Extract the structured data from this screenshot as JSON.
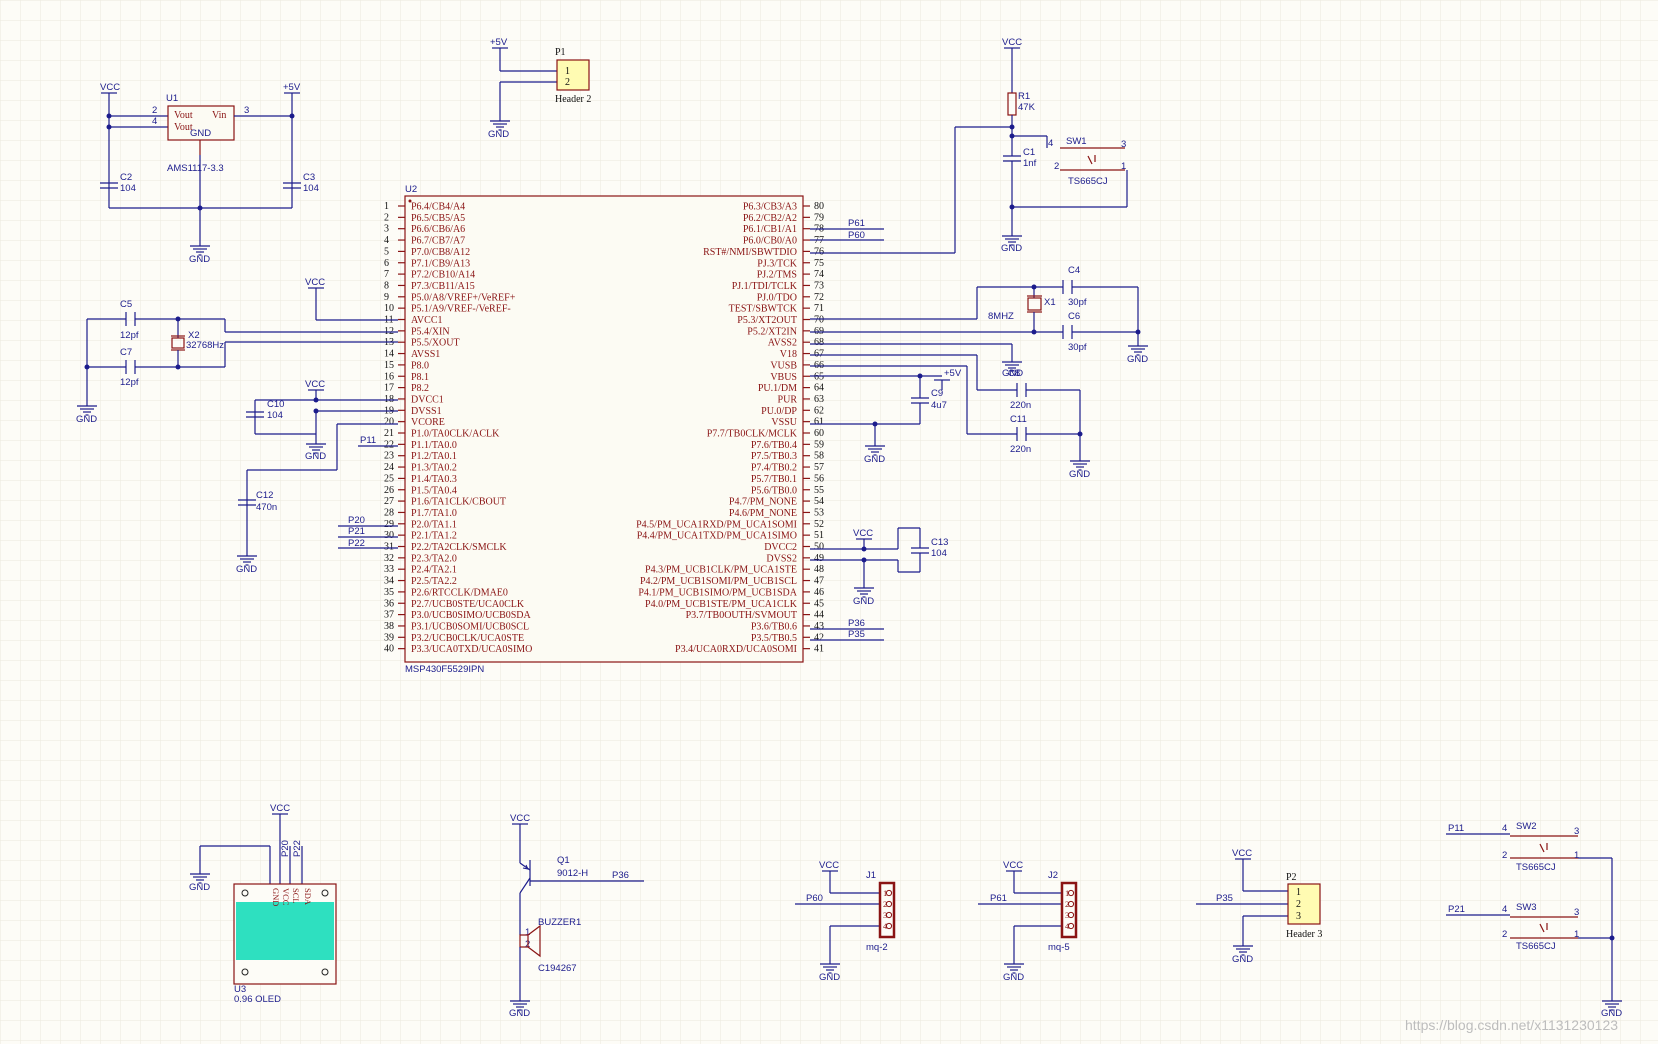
{
  "watermark": "https://blog.csdn.net/x1131230123",
  "mcu": {
    "designator": "U2",
    "part": "MSP430F5529IPN",
    "left_pins": [
      "P6.4/CB4/A4",
      "P6.5/CB5/A5",
      "P6.6/CB6/A6",
      "P6.7/CB7/A7",
      "P7.0/CB8/A12",
      "P7.1/CB9/A13",
      "P7.2/CB10/A14",
      "P7.3/CB11/A15",
      "P5.0/A8/VREF+/VeREF+",
      "P5.1/A9/VREF-/VeREF-",
      "AVCC1",
      "P5.4/XIN",
      "P5.5/XOUT",
      "AVSS1",
      "P8.0",
      "P8.1",
      "P8.2",
      "DVCC1",
      "DVSS1",
      "VCORE",
      "P1.0/TA0CLK/ACLK",
      "P1.1/TA0.0",
      "P1.2/TA0.1",
      "P1.3/TA0.2",
      "P1.4/TA0.3",
      "P1.5/TA0.4",
      "P1.6/TA1CLK/CBOUT",
      "P1.7/TA1.0",
      "P2.0/TA1.1",
      "P2.1/TA1.2",
      "P2.2/TA2CLK/SMCLK",
      "P2.3/TA2.0",
      "P2.4/TA2.1",
      "P2.5/TA2.2",
      "P2.6/RTCCLK/DMAE0",
      "P2.7/UCB0STE/UCA0CLK",
      "P3.0/UCB0SIMO/UCB0SDA",
      "P3.1/UCB0SOMI/UCB0SCL",
      "P3.2/UCB0CLK/UCA0STE",
      "P3.3/UCA0TXD/UCA0SIMO"
    ],
    "right_pins": [
      "P6.3/CB3/A3",
      "P6.2/CB2/A2",
      "P6.1/CB1/A1",
      "P6.0/CB0/A0",
      "RST#/NMI/SBWTDIO",
      "PJ.3/TCK",
      "PJ.2/TMS",
      "PJ.1/TDI/TCLK",
      "PJ.0/TDO",
      "TEST/SBWTCK",
      "P5.3/XT2OUT",
      "P5.2/XT2IN",
      "AVSS2",
      "V18",
      "VUSB",
      "VBUS",
      "PU.1/DM",
      "PUR",
      "PU.0/DP",
      "VSSU",
      "P7.7/TB0CLK/MCLK",
      "P7.6/TB0.4",
      "P7.5/TB0.3",
      "P7.4/TB0.2",
      "P5.7/TB0.1",
      "P5.6/TB0.0",
      "P4.7/PM_NONE",
      "P4.6/PM_NONE",
      "P4.5/PM_UCA1RXD/PM_UCA1SOMI",
      "P4.4/PM_UCA1TXD/PM_UCA1SIMO",
      "DVCC2",
      "DVSS2",
      "P4.3/PM_UCB1CLK/PM_UCA1STE",
      "P4.2/PM_UCB1SOMI/PM_UCB1SCL",
      "P4.1/PM_UCB1SIMO/PM_UCB1SDA",
      "P4.0/PM_UCB1STE/PM_UCA1CLK",
      "P3.7/TB0OUTH/SVMOUT",
      "P3.6/TB0.6",
      "P3.5/TB0.5",
      "P3.4/UCA0RXD/UCA0SOMI"
    ],
    "left_pin_numbers": [
      "1",
      "2",
      "3",
      "4",
      "5",
      "6",
      "7",
      "8",
      "9",
      "10",
      "11",
      "12",
      "13",
      "14",
      "15",
      "16",
      "17",
      "18",
      "19",
      "20",
      "21",
      "22",
      "23",
      "24",
      "25",
      "26",
      "27",
      "28",
      "29",
      "30",
      "31",
      "32",
      "33",
      "34",
      "35",
      "36",
      "37",
      "38",
      "39",
      "40"
    ],
    "right_pin_numbers": [
      "80",
      "79",
      "78",
      "77",
      "76",
      "75",
      "74",
      "73",
      "72",
      "71",
      "70",
      "69",
      "68",
      "67",
      "66",
      "65",
      "64",
      "63",
      "62",
      "61",
      "60",
      "59",
      "58",
      "57",
      "56",
      "55",
      "54",
      "53",
      "52",
      "51",
      "50",
      "49",
      "48",
      "47",
      "46",
      "45",
      "44",
      "43",
      "42",
      "41"
    ],
    "net_labels": {
      "p61": "P61",
      "p60": "P60",
      "p36": "P36",
      "p35": "P35",
      "p11": "P11",
      "p20": "P20",
      "p21": "P21",
      "p22": "P22"
    }
  },
  "regulator": {
    "designator": "U1",
    "part": "AMS1117-3.3",
    "pin_vout1": "Vout",
    "pin_vout2": "Vout",
    "pin_vin": "Vin",
    "pin_gnd": "GND",
    "n2": "2",
    "n4": "4",
    "n3": "3",
    "n1": "1",
    "vcc": "VCC",
    "plus5": "+5V",
    "gnd": "GND",
    "c2": "C2",
    "c2_val": "104",
    "c3": "C3",
    "c3_val": "104"
  },
  "power_header": {
    "designator": "P1",
    "part": "Header 2",
    "pin1": "1",
    "pin2": "2",
    "plus5": "+5V",
    "gnd": "GND"
  },
  "reset": {
    "vcc": "VCC",
    "r1": "R1",
    "r1_val": "47K",
    "c1": "C1",
    "c1_val": "1nf",
    "gnd": "GND",
    "sw": "SW1",
    "sw_part": "TS665CJ",
    "n4": "4",
    "n3": "3",
    "n2": "2",
    "n1": "1"
  },
  "hf_crystal": {
    "c4": "C4",
    "c4_val": "30pf",
    "c6": "C6",
    "c6_val": "30pf",
    "x1": "X1",
    "x1_val": "8MHZ",
    "gnd": "GND"
  },
  "lf_crystal": {
    "c5": "C5",
    "c5_val": "12pf",
    "c7": "C7",
    "c7_val": "12pf",
    "x2": "X2",
    "x2_val": "32768Hz",
    "gnd": "GND"
  },
  "avcc": {
    "vcc": "VCC"
  },
  "dvcc1": {
    "vcc": "VCC",
    "c10": "C10",
    "c10_val": "104",
    "gnd": "GND"
  },
  "vcore": {
    "c12": "C12",
    "c12_val": "470n",
    "gnd": "GND"
  },
  "usb": {
    "plus5": "+5V",
    "c9": "C9",
    "c9_val": "4u7",
    "c8": "C8",
    "c8_val": "220n",
    "c11": "C11",
    "c11_val": "220n",
    "gnd_vssu": "GND",
    "gnd_c8": "GND",
    "gnd_c11": "GND"
  },
  "dvcc2": {
    "vcc": "VCC",
    "c13": "C13",
    "c13_val": "104",
    "gnd": "GND"
  },
  "oled": {
    "designator": "U3",
    "part": "0.96 OLED",
    "vcc": "VCC",
    "gnd": "GND",
    "net_p20": "P20",
    "net_p22": "P22",
    "pin_gnd": "GND",
    "pin_vcc": "VCC",
    "pin_scl": "SCL",
    "pin_sda": "SDA",
    "n1": "1",
    "n2": "2",
    "n3": "3",
    "n4": "4"
  },
  "buzzer": {
    "vcc": "VCC",
    "q1": "Q1",
    "q1_part": "9012-H",
    "net": "P36",
    "buzzer": "BUZZER1",
    "buzzer_part": "C194267",
    "n1": "1",
    "n2": "2",
    "gnd": "GND"
  },
  "sensor1": {
    "designator": "J1",
    "part": "mq-2",
    "vcc": "VCC",
    "net": "P60",
    "gnd": "GND",
    "pins": [
      "1",
      "2",
      "3",
      "4"
    ]
  },
  "sensor2": {
    "designator": "J2",
    "part": "mq-5",
    "vcc": "VCC",
    "net": "P61",
    "gnd": "GND",
    "pins": [
      "1",
      "2",
      "3",
      "4"
    ]
  },
  "header3": {
    "designator": "P2",
    "part": "Header 3",
    "vcc": "VCC",
    "net": "P35",
    "gnd": "GND",
    "pins": [
      "1",
      "2",
      "3"
    ]
  },
  "keys": {
    "sw2": "SW2",
    "sw2_part": "TS665CJ",
    "sw2_net": "P11",
    "sw3": "SW3",
    "sw3_part": "TS665CJ",
    "sw3_net": "P21",
    "n4": "4",
    "n3": "3",
    "n2": "2",
    "n1": "1",
    "gnd": "GND"
  }
}
